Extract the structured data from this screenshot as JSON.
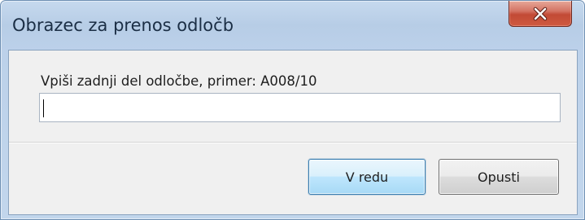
{
  "window": {
    "title": "Obrazec za prenos odločb",
    "close_icon": "close-icon"
  },
  "dialog": {
    "prompt": "Vpiši zadnji del odločbe, primer: A008/10",
    "input_value": ""
  },
  "buttons": {
    "ok_label": "V redu",
    "cancel_label": "Opusti"
  },
  "colors": {
    "frame": "#bcd1ea",
    "close_button": "#c24a35",
    "default_button_border": "#3c7fb1",
    "client_background": "#f0f0f0"
  }
}
